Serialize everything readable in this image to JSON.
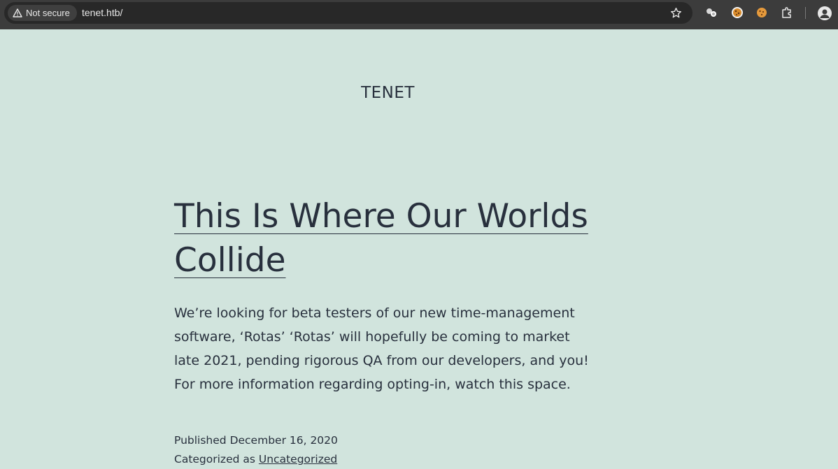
{
  "browser": {
    "security_label": "Not secure",
    "url": "tenet.htb/",
    "icons": [
      "warning-icon",
      "star-icon",
      "extension-icon",
      "cookie-icon",
      "cookie-icon",
      "puzzle-icon",
      "profile-icon"
    ]
  },
  "site": {
    "title": "TENET"
  },
  "post": {
    "title": "This Is Where Our Worlds Collide",
    "excerpt": "We’re looking for beta testers of our new time-management software, ‘Rotas’ ‘Rotas’ will hopefully be coming to market late 2021, pending rigorous QA from our developers, and you! For more information regarding opting-in, watch this space.",
    "published_label": "Published",
    "published_date": "December 16, 2020",
    "categorized_label": "Categorized as",
    "category": "Uncategorized"
  },
  "colors": {
    "page_background": "#d1e4dd",
    "text": "#28303d",
    "chrome_background": "#3c3c3c",
    "omnibox_background": "#282828"
  }
}
